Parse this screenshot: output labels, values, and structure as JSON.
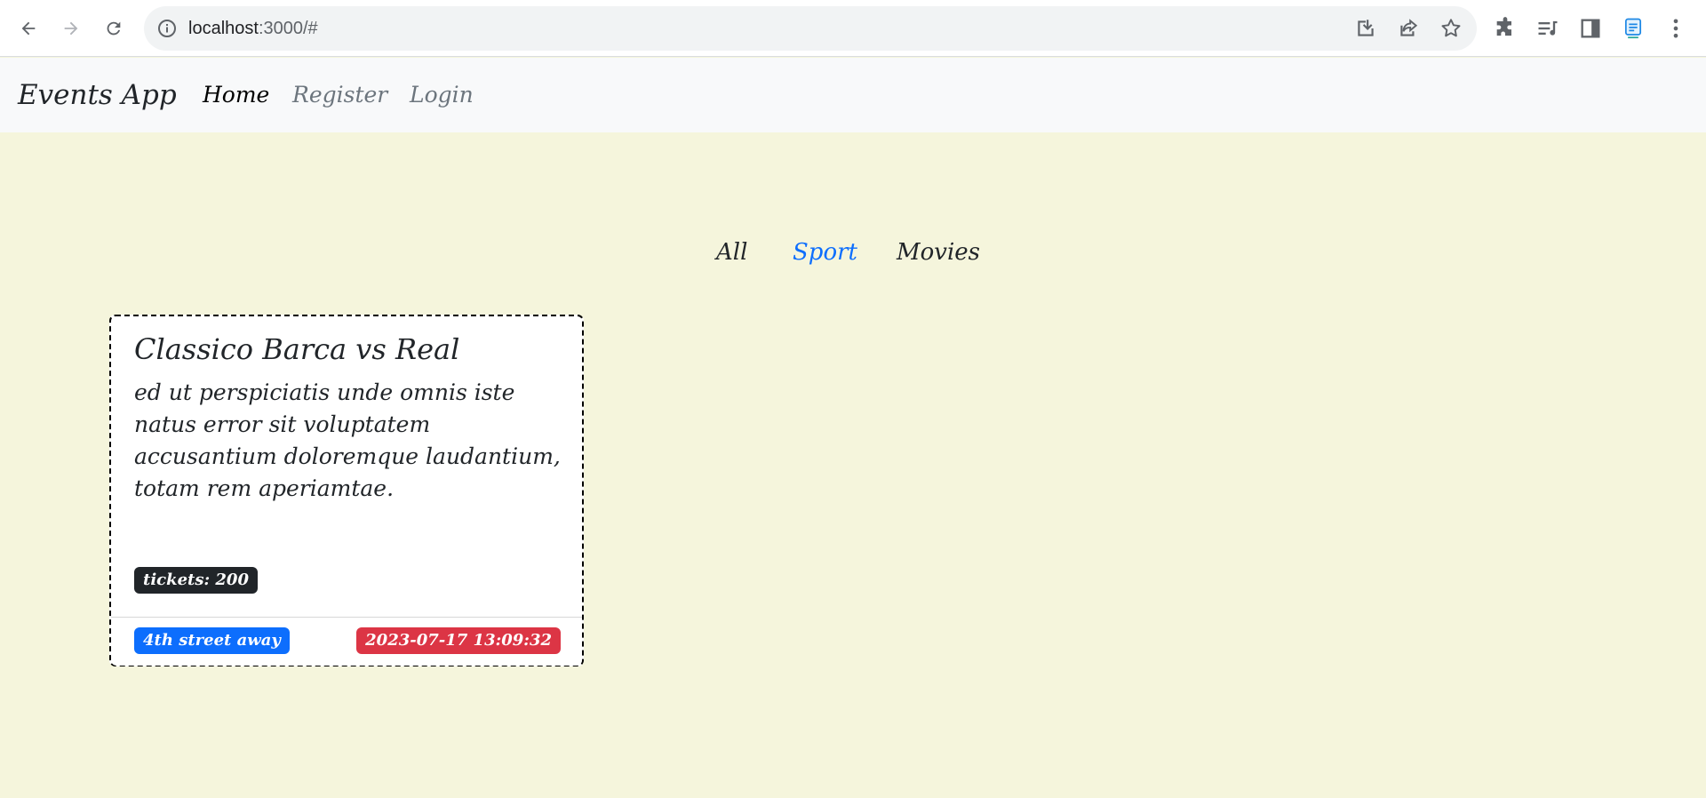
{
  "browser": {
    "url_host": "localhost",
    "url_rest": ":3000/#"
  },
  "navbar": {
    "brand": "Events App",
    "links": [
      {
        "label": "Home",
        "active": true
      },
      {
        "label": "Register",
        "active": false
      },
      {
        "label": "Login",
        "active": false
      }
    ]
  },
  "filters": [
    {
      "label": "All",
      "selected": false
    },
    {
      "label": "Sport",
      "selected": true
    },
    {
      "label": "Movies",
      "selected": false
    }
  ],
  "event_card": {
    "title": "Classico Barca vs Real",
    "description": "ed ut perspiciatis unde omnis iste natus error sit voluptatem accusantium doloremque laudantium, totam rem aperiamtae.",
    "tickets": "tickets: 200",
    "location": "4th street away",
    "datetime": "2023-07-17 13:09:32"
  },
  "colors": {
    "page_background": "#f5f5dc",
    "accent_blue": "#0d6efd",
    "badge_dark": "#212529",
    "badge_red": "#dc3545"
  }
}
